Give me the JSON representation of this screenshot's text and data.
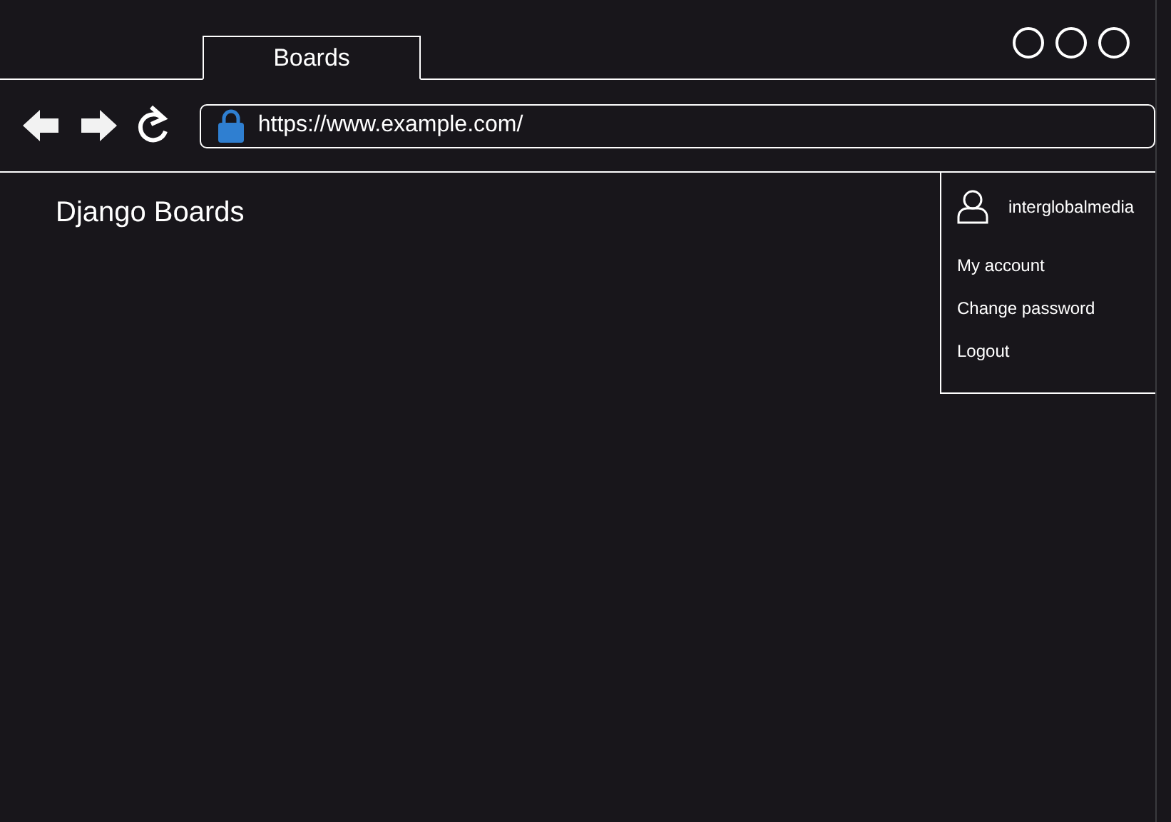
{
  "tabs": [
    {
      "label": "Boards",
      "selected": true
    }
  ],
  "address_bar": {
    "url": "https://www.example.com/",
    "secure": true
  },
  "page": {
    "title": "Django Boards"
  },
  "user_menu": {
    "username": "interglobalmedia",
    "items": [
      {
        "label": "My account"
      },
      {
        "label": "Change password"
      },
      {
        "label": "Logout"
      }
    ]
  }
}
